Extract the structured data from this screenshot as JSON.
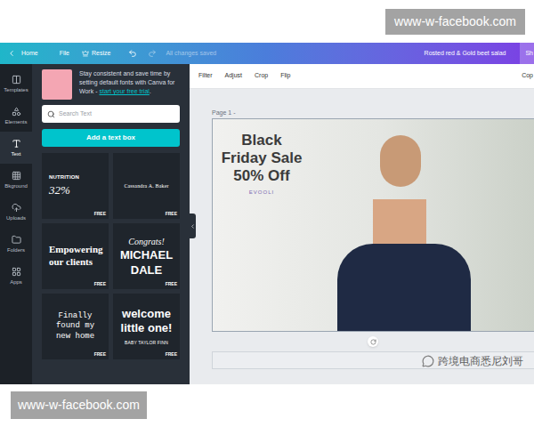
{
  "watermarks": {
    "top": "www-w-facebook.com",
    "bottom": "www-w-facebook.com",
    "channel": "跨境电商悉尼刘哥"
  },
  "topbar": {
    "items": [
      "Home",
      "File",
      "Resize"
    ],
    "status": "All changes saved",
    "title": "Rosted red & Gold beet salad",
    "share": "Sh"
  },
  "rail": [
    {
      "label": "Templates",
      "selected": false
    },
    {
      "label": "Elements",
      "selected": false
    },
    {
      "label": "Text",
      "selected": true
    },
    {
      "label": "Bkground",
      "selected": false
    },
    {
      "label": "Uploads",
      "selected": false
    },
    {
      "label": "Folders",
      "selected": false
    },
    {
      "label": "Apps",
      "selected": false
    }
  ],
  "promo": {
    "text": "Stay consistent and save time by setting default fonts with Canva for Work - ",
    "link": "start your free trial",
    "after": "."
  },
  "search": {
    "placeholder": "Search Text"
  },
  "add_button": "Add a text box",
  "templates": [
    {
      "kind": "nutrition",
      "lines": [
        "NUTRITION",
        "32%"
      ],
      "badge": "FREE"
    },
    {
      "kind": "signature",
      "lines": [
        "Cassandra A. Baker"
      ],
      "badge": "FREE"
    },
    {
      "kind": "statement",
      "lines": [
        "Empowering our clients"
      ],
      "badge": "FREE"
    },
    {
      "kind": "congrats",
      "lines": [
        "Congrats!",
        "MICHAEL DALE"
      ],
      "badge": "FREE"
    },
    {
      "kind": "serif",
      "lines": [
        "Finally found my new home"
      ],
      "badge": "FREE"
    },
    {
      "kind": "welcome",
      "lines": [
        "welcome little one!",
        "BABY TAYLOR FINN"
      ],
      "badge": "FREE"
    }
  ],
  "toolbar": {
    "items": [
      "Filter",
      "Adjust",
      "Crop",
      "Flip"
    ],
    "right": "Cop"
  },
  "page": {
    "label": "Page 1 -",
    "design": {
      "headline": [
        "Black",
        "Friday Sale",
        "50% Off"
      ],
      "brand": "EVOOLI"
    }
  }
}
